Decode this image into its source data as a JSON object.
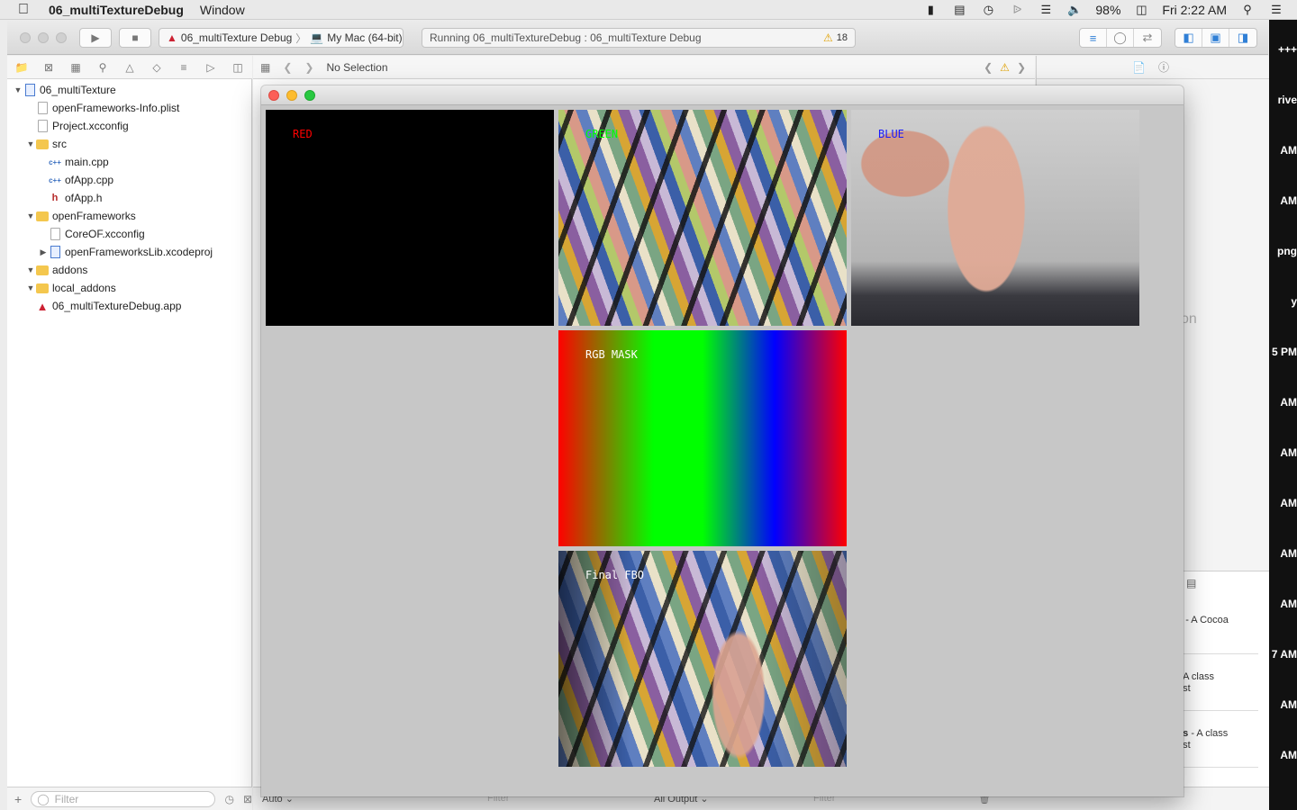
{
  "menubar": {
    "app_name": "06_multiTextureDebug",
    "menus": [
      "Window"
    ],
    "battery": "98%",
    "clock": "Fri 2:22 AM"
  },
  "toolbar": {
    "scheme": "06_multiTexture Debug",
    "destination": "My Mac (64-bit)",
    "status": "Running 06_multiTextureDebug : 06_multiTexture Debug",
    "warnings": "18"
  },
  "jumpbar": {
    "selection": "No Selection"
  },
  "navigator": {
    "tree": [
      {
        "label": "06_multiTexture",
        "indent": 0,
        "kind": "project",
        "disclosure": "open"
      },
      {
        "label": "openFrameworks-Info.plist",
        "indent": 1,
        "kind": "doc"
      },
      {
        "label": "Project.xcconfig",
        "indent": 1,
        "kind": "doc"
      },
      {
        "label": "src",
        "indent": 1,
        "kind": "folder",
        "disclosure": "open"
      },
      {
        "label": "main.cpp",
        "indent": 2,
        "kind": "cpp"
      },
      {
        "label": "ofApp.cpp",
        "indent": 2,
        "kind": "cpp"
      },
      {
        "label": "ofApp.h",
        "indent": 2,
        "kind": "h"
      },
      {
        "label": "openFrameworks",
        "indent": 1,
        "kind": "folder",
        "disclosure": "open"
      },
      {
        "label": "CoreOF.xcconfig",
        "indent": 2,
        "kind": "doc"
      },
      {
        "label": "openFrameworksLib.xcodeproj",
        "indent": 2,
        "kind": "project",
        "disclosure": "closed"
      },
      {
        "label": "addons",
        "indent": 1,
        "kind": "folder",
        "disclosure": "open"
      },
      {
        "label": "local_addons",
        "indent": 1,
        "kind": "folder",
        "disclosure": "open"
      },
      {
        "label": "06_multiTextureDebug.app",
        "indent": 1,
        "kind": "app"
      }
    ],
    "filter_placeholder": "Filter"
  },
  "debugbar": {
    "auto_label": "Auto",
    "output_label": "All Output",
    "filter_placeholder": "Filter"
  },
  "inspector": {
    "library_items": [
      {
        "name": "s",
        "desc": "- A Cocoa"
      },
      {
        "name": "",
        "desc": "- A class",
        "sub": "est"
      },
      {
        "name": "ss",
        "desc": "- A class",
        "sub": "est"
      }
    ],
    "ghost_text": "on"
  },
  "right_edge": [
    "+++",
    "rive",
    "AM",
    "AM",
    "png",
    "y",
    "5 PM",
    "AM",
    "AM",
    "AM",
    "AM",
    "AM",
    "7 AM",
    "AM",
    "AM"
  ],
  "of_window": {
    "panels": [
      {
        "id": "red",
        "label": "RED",
        "label_color": "#ff0000"
      },
      {
        "id": "green",
        "label": "GREEN",
        "label_color": "#00ff00"
      },
      {
        "id": "blue",
        "label": "BLUE",
        "label_color": "#1a1aff"
      },
      {
        "id": "mask",
        "label": "RGB MASK",
        "label_color": "#ffffff"
      },
      {
        "id": "final",
        "label": "Final FBO",
        "label_color": "#ffffff"
      }
    ]
  }
}
